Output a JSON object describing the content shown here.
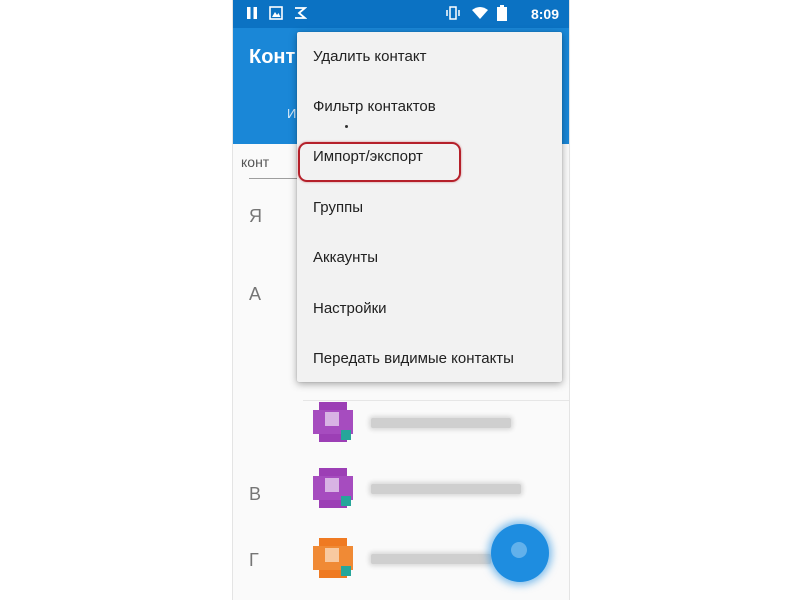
{
  "status_bar": {
    "time": "8:09",
    "left_icons": [
      "pause-icon",
      "image-icon",
      "flag-icon"
    ],
    "right_icons": [
      "vibrate-icon",
      "wifi-icon",
      "battery-icon"
    ]
  },
  "app_bar": {
    "title": "Конт",
    "tab_label": "И"
  },
  "search": {
    "label": "конт"
  },
  "sections": [
    "Я",
    "А",
    "В",
    "Г"
  ],
  "contacts": [
    {
      "avatar_color": "#8e24aa",
      "section": "А"
    },
    {
      "avatar_color": "#8e24aa",
      "section": "В"
    },
    {
      "avatar_color": "#ef6c00",
      "section": "Г"
    }
  ],
  "menu": {
    "items": [
      "Удалить контакт",
      "Фильтр контактов",
      "Импорт/экспорт",
      "Группы",
      "Аккаунты",
      "Настройки",
      "Передать видимые контакты"
    ],
    "highlighted_index": 2
  },
  "colors": {
    "status_bar": "#0b72c3",
    "app_bar": "#1a87d7",
    "highlight": "#b5202a",
    "fab": "#1e8de0"
  }
}
